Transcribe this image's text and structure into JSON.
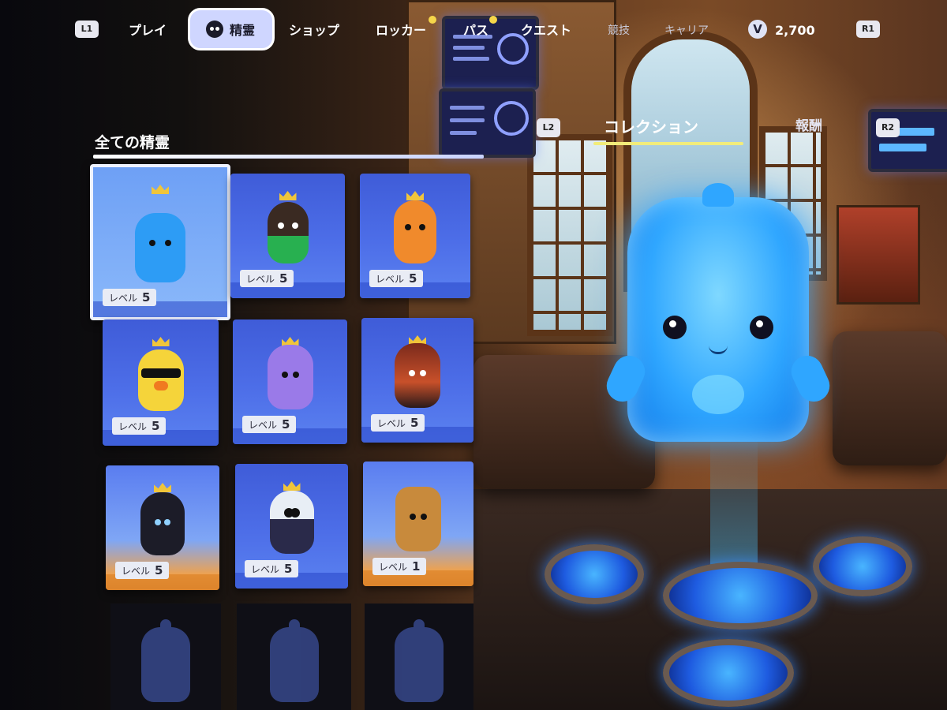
{
  "nav": {
    "l1_key": "L1",
    "r1_key": "R1",
    "items": [
      "プレイ",
      "ショップ",
      "ロッカー",
      "パス",
      "クエスト"
    ],
    "active_label": "精霊",
    "dim_items": [
      "競技",
      "キャリア"
    ],
    "vbucks_symbol": "V",
    "vbucks_amount": "2,700"
  },
  "panel": {
    "title": "全ての精霊",
    "level_label": "レベル",
    "cards": [
      {
        "level": "5",
        "selected": true
      },
      {
        "level": "5"
      },
      {
        "level": "5"
      },
      {
        "level": "5"
      },
      {
        "level": "5"
      },
      {
        "level": "5"
      },
      {
        "level": "5"
      },
      {
        "level": "5"
      },
      {
        "level": "1"
      }
    ]
  },
  "preview": {
    "l2_key": "L2",
    "r2_key": "R2",
    "tab_collection": "コレクション",
    "tab_reward": "報酬"
  },
  "colors": {
    "accent_underline": "#f2ec7a",
    "card_blue": "#4d6ee8",
    "notification": "#f5d64a"
  }
}
